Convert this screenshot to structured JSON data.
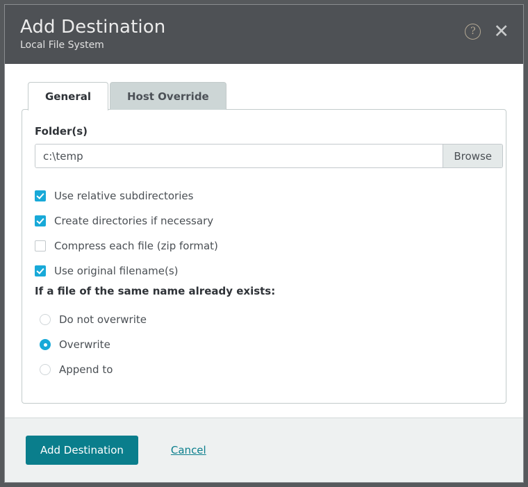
{
  "header": {
    "title": "Add Destination",
    "subtitle": "Local File System",
    "help_icon": "question-mark-circle-icon",
    "close_icon": "close-x-icon",
    "background_color": "#4e5155"
  },
  "tabs": [
    {
      "label": "General",
      "active": true
    },
    {
      "label": "Host Override",
      "active": false
    }
  ],
  "form": {
    "folder_label": "Folder(s)",
    "folder_value": "c:\\temp",
    "folder_placeholder": "",
    "browse_label": "Browse"
  },
  "checkboxes": [
    {
      "label": "Use relative subdirectories",
      "checked": true
    },
    {
      "label": "Create directories if necessary",
      "checked": true
    },
    {
      "label": "Compress each file (zip format)",
      "checked": false
    },
    {
      "label": "Use original filename(s)",
      "checked": true
    }
  ],
  "overwrite_group": {
    "label": "If a file of the same name already exists:",
    "options": [
      {
        "label": "Do not overwrite",
        "selected": false
      },
      {
        "label": "Overwrite",
        "selected": true
      },
      {
        "label": "Append to",
        "selected": false
      }
    ]
  },
  "footer": {
    "submit_label": "Add Destination",
    "cancel_label": "Cancel"
  },
  "colors": {
    "accent_teal": "#0a7e8c",
    "accent_cyan": "#18a9d8",
    "header_bg": "#4e5155",
    "footer_bg": "#eef1f1",
    "page_bg": "#56595c"
  }
}
